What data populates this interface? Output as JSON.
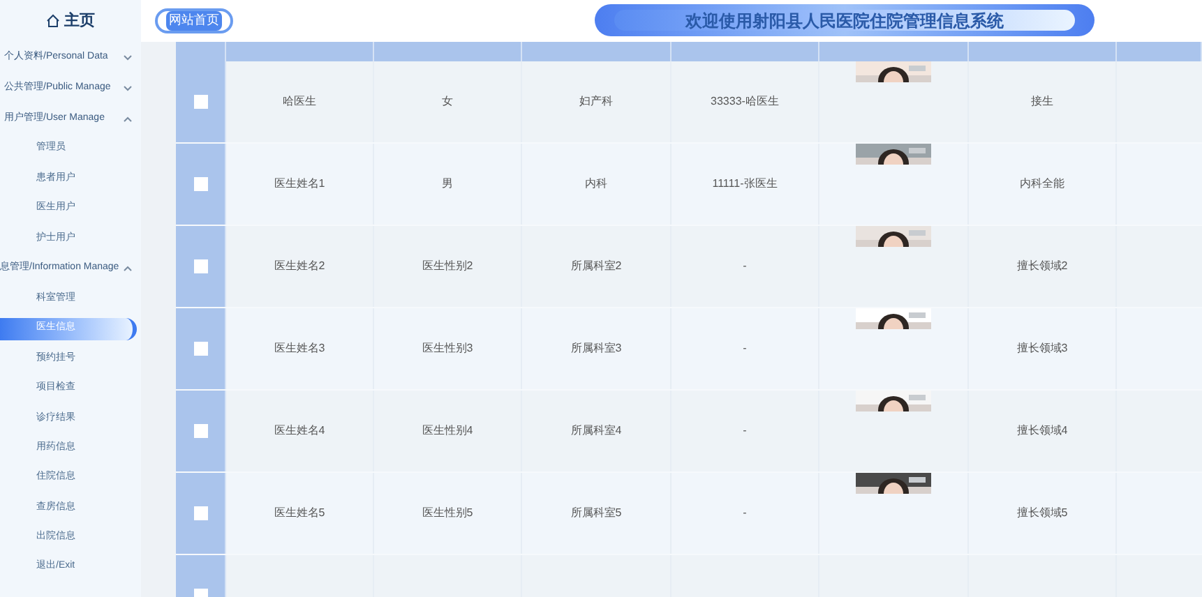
{
  "sidebar": {
    "home": "主页",
    "items": [
      {
        "kind": "group",
        "label": "个人资料/Personal Data",
        "expanded": false
      },
      {
        "kind": "group",
        "label": "公共管理/Public Manage",
        "expanded": false
      },
      {
        "kind": "group",
        "label": "用户管理/User Manage",
        "expanded": true,
        "children": [
          {
            "label": "管理员",
            "selected": false
          },
          {
            "label": "患者用户",
            "selected": false
          },
          {
            "label": "医生用户",
            "selected": false
          },
          {
            "label": "护士用户",
            "selected": false
          }
        ]
      },
      {
        "kind": "group",
        "label": "息管理/Information Manage",
        "expanded": true,
        "children": [
          {
            "label": "科室管理",
            "selected": false
          },
          {
            "label": "医生信息",
            "selected": true
          },
          {
            "label": "预约挂号",
            "selected": false
          },
          {
            "label": "项目检查",
            "selected": false
          },
          {
            "label": "诊疗结果",
            "selected": false
          },
          {
            "label": "用药信息",
            "selected": false
          },
          {
            "label": "住院信息",
            "selected": false
          },
          {
            "label": "查房信息",
            "selected": false
          },
          {
            "label": "出院信息",
            "selected": false
          }
        ]
      },
      {
        "kind": "link",
        "label": "退出/Exit"
      }
    ]
  },
  "header": {
    "home_button": "网站首页",
    "title": "欢迎使用射阳县人民医院住院管理信息系统"
  },
  "table": {
    "rows": [
      {
        "checked": false,
        "name": "哈医生",
        "gender": "女",
        "department": "妇产科",
        "phone": "33333-哈医生",
        "specialty": "接生"
      },
      {
        "checked": false,
        "name": "医生姓名1",
        "gender": "男",
        "department": "内科",
        "phone": "11111-张医生",
        "specialty": "内科全能"
      },
      {
        "checked": false,
        "name": "医生姓名2",
        "gender": "医生性别2",
        "department": "所属科室2",
        "phone": "-",
        "specialty": "擅长领域2"
      },
      {
        "checked": false,
        "name": "医生姓名3",
        "gender": "医生性别3",
        "department": "所属科室3",
        "phone": "-",
        "specialty": "擅长领域3"
      },
      {
        "checked": false,
        "name": "医生姓名4",
        "gender": "医生性别4",
        "department": "所属科室4",
        "phone": "-",
        "specialty": "擅长领域4"
      },
      {
        "checked": false,
        "name": "医生姓名5",
        "gender": "医生性别5",
        "department": "所属科室5",
        "phone": "-",
        "specialty": "擅长领域5"
      },
      {
        "checked": false
      }
    ]
  }
}
